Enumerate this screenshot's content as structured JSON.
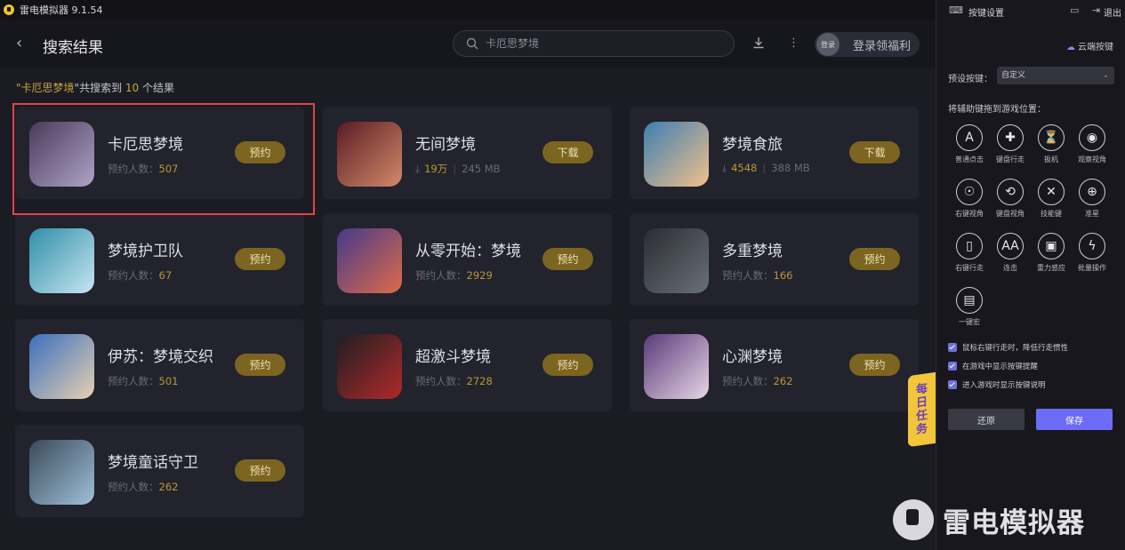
{
  "window": {
    "title": "雷电模拟器 9.1.54"
  },
  "header": {
    "page_title": "搜索结果",
    "search_placeholder": "卡厄思梦境",
    "login_avatar_text": "登录",
    "login_label": "登录领福利"
  },
  "summary": {
    "prefix": "\"",
    "keyword": "卡厄思梦境",
    "mid": "\"共搜索到 ",
    "count": "10",
    "suffix": " 个结果"
  },
  "results": [
    {
      "name": "卡厄思梦境",
      "meta_label": "预约人数：",
      "meta_value": "507",
      "size": "",
      "action": "预约",
      "colors": [
        "#4a3a5a",
        "#b0a3c6"
      ]
    },
    {
      "name": "无间梦境",
      "meta_label": "",
      "meta_value": "19万",
      "size": "245 MB",
      "action": "下载",
      "colors": [
        "#5a1c24",
        "#d38a6a"
      ]
    },
    {
      "name": "梦境食旅",
      "meta_label": "",
      "meta_value": "4548",
      "size": "388 MB",
      "action": "下载",
      "colors": [
        "#3d7fb2",
        "#f2c08a"
      ]
    },
    {
      "name": "梦境护卫队",
      "meta_label": "预约人数：",
      "meta_value": "67",
      "size": "",
      "action": "预约",
      "colors": [
        "#2f8ea8",
        "#c6e6f0"
      ]
    },
    {
      "name": "从零开始：梦境",
      "meta_label": "预约人数：",
      "meta_value": "2929",
      "size": "",
      "action": "预约",
      "colors": [
        "#433a8a",
        "#e06a4a"
      ]
    },
    {
      "name": "多重梦境",
      "meta_label": "预约人数：",
      "meta_value": "166",
      "size": "",
      "action": "预约",
      "colors": [
        "#2a2d33",
        "#6a7078"
      ]
    },
    {
      "name": "伊苏：梦境交织",
      "meta_label": "预约人数：",
      "meta_value": "501",
      "size": "",
      "action": "预约",
      "colors": [
        "#3a6fc0",
        "#e6d0b0"
      ]
    },
    {
      "name": "超激斗梦境",
      "meta_label": "预约人数：",
      "meta_value": "2728",
      "size": "",
      "action": "预约",
      "colors": [
        "#1e1e22",
        "#b12a2a"
      ]
    },
    {
      "name": "心渊梦境",
      "meta_label": "预约人数：",
      "meta_value": "262",
      "size": "",
      "action": "预约",
      "colors": [
        "#5a3a7a",
        "#e8d6e6"
      ]
    },
    {
      "name": "梦境童话守卫",
      "meta_label": "预约人数：",
      "meta_value": "262",
      "size": "",
      "action": "预约",
      "colors": [
        "#3a4a5a",
        "#9fc0d8"
      ]
    }
  ],
  "task_badge": [
    "每",
    "日",
    "任",
    "务"
  ],
  "panel": {
    "title": "按键设置",
    "exit": "退出",
    "cloud": "云端按键",
    "preset_label": "预设按键：",
    "preset_value": "自定义",
    "drag_hint": "将辅助键拖到游戏位置：",
    "keys": [
      {
        "label": "普通点击",
        "glyph": "A",
        "icon": "click-icon"
      },
      {
        "label": "键盘行走",
        "glyph": "✚",
        "icon": "dpad-icon"
      },
      {
        "label": "扳机",
        "glyph": "⏳",
        "icon": "trigger-icon"
      },
      {
        "label": "观察视角",
        "glyph": "◉",
        "icon": "eye-icon"
      },
      {
        "label": "右键视角",
        "glyph": "☉",
        "icon": "right-view-icon"
      },
      {
        "label": "键盘视角",
        "glyph": "⟲",
        "icon": "keyboard-view-icon"
      },
      {
        "label": "技能键",
        "glyph": "✕",
        "icon": "skill-icon"
      },
      {
        "label": "准星",
        "glyph": "⊕",
        "icon": "crosshair-icon"
      },
      {
        "label": "右键行走",
        "glyph": "▯",
        "icon": "mouse-icon"
      },
      {
        "label": "连击",
        "glyph": "AA",
        "icon": "combo-icon"
      },
      {
        "label": "重力感应",
        "glyph": "▣",
        "icon": "gravity-icon"
      },
      {
        "label": "批量操作",
        "glyph": "ϟ",
        "icon": "bolt-icon"
      },
      {
        "label": "一键宏",
        "glyph": "▤",
        "icon": "macro-icon"
      }
    ],
    "checks": [
      "鼠标右键行走时，降低行走惯性",
      "在游戏中显示按键提醒",
      "进入游戏时显示按键说明"
    ],
    "reset": "还原",
    "save": "保存"
  },
  "watermark": "雷电模拟器",
  "colors": {
    "accent": "#6d6cf4",
    "gold": "#c9a53a",
    "highlight": "#e04545"
  }
}
